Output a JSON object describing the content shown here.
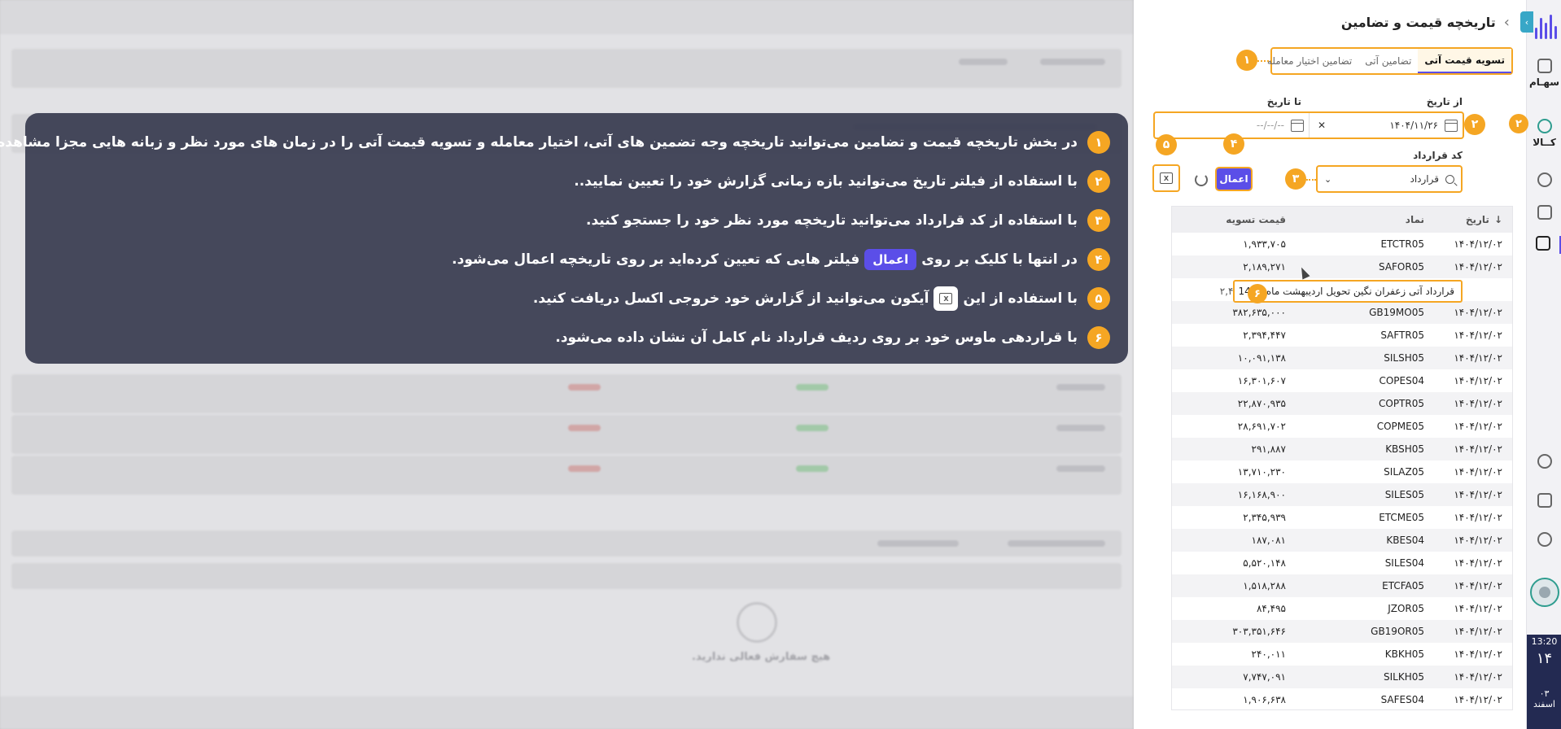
{
  "overlay": {
    "lines": [
      {
        "num": "۱",
        "before": "در بخش تاریخچه قیمت و تضامین می‌توانید تاریخچه وجه تضمین های آتی، اختیار معامله و تسویه قیمت آتی را در زمان های مورد نظر و زبانه هایی مجزا مشاهده نمایید."
      },
      {
        "num": "۲",
        "before": "با استفاده از فیلتر تاریخ می‌توانید بازه زمانی گزارش خود را تعیین نمایید.."
      },
      {
        "num": "۳",
        "before": "با استفاده از کد قرارداد می‌توانید تاریخچه مورد نظر خود را جستجو کنید."
      },
      {
        "num": "۴",
        "before": "در انتها با کلیک بر روی",
        "pill": "اعمال",
        "after": "فیلتر هایی که تعیین کرده‌اید بر روی تاریخچه اعمال می‌شود."
      },
      {
        "num": "۵",
        "before": "با استفاده از این",
        "after": "آیکون می‌توانید از گزارش خود خروجی اکسل دریافت کنید."
      },
      {
        "num": "۶",
        "before": "با قراردهی ماوس خود بر روی ردیف قرارداد نام کامل آن نشان داده می‌شود."
      }
    ]
  },
  "background": {
    "empty_text": "هیچ سفارش فعالی ندارید."
  },
  "panel": {
    "title": "تاریخچه قیمت و تضامین",
    "tabs": [
      "تسویه قیمت آتی",
      "تضامین آتی",
      "تضامین اختیار معامله"
    ],
    "from_label": "از تاریخ",
    "to_label": "تا تاریخ",
    "from_value": "۱۴۰۴/۱۱/۲۶",
    "to_value": "--/--/--",
    "contract_label": "کد قرارداد",
    "contract_placeholder": "قرارداد",
    "apply_label": "اعمال",
    "markers": [
      "۱",
      "۲",
      "۳",
      "۴",
      "۵",
      "۶"
    ],
    "tooltip": "قرارداد آتی زعفران نگین تحویل اردیبهشت ماه 1405",
    "tooltip_partial": "۲,۴",
    "table": {
      "headers": {
        "date": "تاریخ",
        "symbol": "نماد",
        "price": "قیمت تسویه"
      },
      "rows": [
        {
          "date": "۱۴۰۴/۱۲/۰۲",
          "symbol": "ETCTR05",
          "price": "۱,۹۳۳,۷۰۵"
        },
        {
          "date": "۱۴۰۴/۱۲/۰۲",
          "symbol": "SAFOR05",
          "price": "۲,۱۸۹,۲۷۱"
        },
        {
          "date": "",
          "symbol": "",
          "price": ""
        },
        {
          "date": "۱۴۰۴/۱۲/۰۲",
          "symbol": "GB19MO05",
          "price": "۳۸۲,۶۳۵,۰۰۰"
        },
        {
          "date": "۱۴۰۴/۱۲/۰۲",
          "symbol": "SAFTR05",
          "price": "۲,۳۹۴,۴۴۷"
        },
        {
          "date": "۱۴۰۴/۱۲/۰۲",
          "symbol": "SILSH05",
          "price": "۱۰,۰۹۱,۱۳۸"
        },
        {
          "date": "۱۴۰۴/۱۲/۰۲",
          "symbol": "COPES04",
          "price": "۱۶,۳۰۱,۶۰۷"
        },
        {
          "date": "۱۴۰۴/۱۲/۰۲",
          "symbol": "COPTR05",
          "price": "۲۲,۸۷۰,۹۳۵"
        },
        {
          "date": "۱۴۰۴/۱۲/۰۲",
          "symbol": "COPME05",
          "price": "۲۸,۶۹۱,۷۰۲"
        },
        {
          "date": "۱۴۰۴/۱۲/۰۲",
          "symbol": "KBSH05",
          "price": "۲۹۱,۸۸۷"
        },
        {
          "date": "۱۴۰۴/۱۲/۰۲",
          "symbol": "SILAZ05",
          "price": "۱۳,۷۱۰,۲۳۰"
        },
        {
          "date": "۱۴۰۴/۱۲/۰۲",
          "symbol": "SILES05",
          "price": "۱۶,۱۶۸,۹۰۰"
        },
        {
          "date": "۱۴۰۴/۱۲/۰۲",
          "symbol": "ETCME05",
          "price": "۲,۳۴۵,۹۳۹"
        },
        {
          "date": "۱۴۰۴/۱۲/۰۲",
          "symbol": "KBES04",
          "price": "۱۸۷,۰۸۱"
        },
        {
          "date": "۱۴۰۴/۱۲/۰۲",
          "symbol": "SILES04",
          "price": "۵,۵۲۰,۱۴۸"
        },
        {
          "date": "۱۴۰۴/۱۲/۰۲",
          "symbol": "ETCFA05",
          "price": "۱,۵۱۸,۲۸۸"
        },
        {
          "date": "۱۴۰۴/۱۲/۰۲",
          "symbol": "JZOR05",
          "price": "۸۴,۴۹۵"
        },
        {
          "date": "۱۴۰۴/۱۲/۰۲",
          "symbol": "GB19OR05",
          "price": "۳۰۳,۳۵۱,۶۴۶"
        },
        {
          "date": "۱۴۰۴/۱۲/۰۲",
          "symbol": "KBKH05",
          "price": "۲۴۰,۰۱۱"
        },
        {
          "date": "۱۴۰۴/۱۲/۰۲",
          "symbol": "SILKH05",
          "price": "۷,۷۴۷,۰۹۱"
        },
        {
          "date": "۱۴۰۴/۱۲/۰۲",
          "symbol": "SAFES04",
          "price": "۱,۹۰۶,۶۳۸"
        }
      ]
    }
  },
  "sidebar": {
    "items": [
      "سهـام",
      "کــالا"
    ],
    "time": "13:20",
    "day": "۱۴",
    "year": "۰۳",
    "month": "اسفند",
    "badges": [
      "۱",
      "۲"
    ]
  },
  "colors": {
    "accent": "#5b4ee8",
    "marker": "#f5a623",
    "overlay": "#3a3e52",
    "clock_bg": "#232a52"
  }
}
